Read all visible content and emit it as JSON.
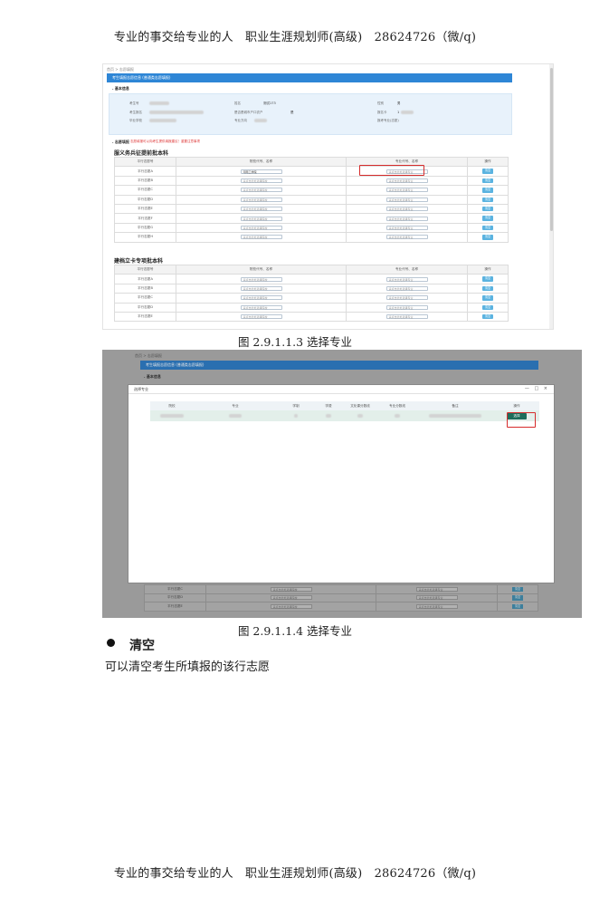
{
  "page": {
    "header": "专业的事交给专业的人　职业生涯规划师(高级)　28624726（微/q)",
    "footer": "专业的事交给专业的人　职业生涯规划师(高级)　28624726（微/q)"
  },
  "figure1": {
    "breadcrumb": "首页 > 志愿填报",
    "title_bar": "考生填报志愿信息 (普通类志愿填报)",
    "basic_info_title": ". 基本信息",
    "info": {
      "exam_no_label": "考生号",
      "candidate_no_label": "考生报名",
      "grad_school_label": "毕业学校",
      "name_label": "姓名",
      "name_value": "测试173",
      "hukou_label": "是否是城市户口农户",
      "hukou_value": "是",
      "major_label": "专业方向",
      "gender_label": "性别",
      "gender_value": "男",
      "score_label": "报名卡",
      "score_value": "1",
      "subject_label": "报考专业(志愿)"
    },
    "fill_title": ". 志愿填报",
    "warning": "志愿填报可以向考生提供填报建议！重要注意事项",
    "group1_title": "服义务兵征提前批本科",
    "group2_title": "建档立卡专项批本科",
    "table_headers": [
      "平行志愿号",
      "院校代号、名称",
      "专业代号、名称",
      "操作"
    ],
    "group1_rows": [
      "平行志愿A",
      "平行志愿B",
      "平行志愿C",
      "平行志愿D",
      "平行志愿E",
      "平行志愿F",
      "平行志愿G",
      "平行志愿H"
    ],
    "group2_rows": [
      "平行志愿A",
      "平行志愿B",
      "平行志愿C",
      "平行志愿D",
      "平行志愿E"
    ],
    "school_placeholder": "请点击此处选择院校",
    "major_placeholder": "请点击此处选择专业",
    "first_school_value": "河南工学院",
    "clear_button": "清空",
    "caption": "图 2.9.1.1.3 选择专业"
  },
  "figure2": {
    "breadcrumb": "首页 > 志愿填报",
    "title_bar": "考生填报志愿信息 (普通类志愿填报)",
    "basic_info_title": ". 基本信息",
    "modal_title": "选择专业",
    "modal_controls": "— □ ×",
    "headers": [
      "院校",
      "专业",
      "学制",
      "学费",
      "文化课分数线",
      "专业分数线",
      "备注",
      "操作"
    ],
    "select_button": "选择",
    "bg_rows": [
      "平行志愿C",
      "平行志愿D",
      "平行志愿E"
    ],
    "school_placeholder": "请点击此处选择院校",
    "major_placeholder": "请点击此处选择专业",
    "clear_button": "清空",
    "caption": "图 2.9.1.1.4 选择专业"
  },
  "section": {
    "bullet_title": "清空",
    "text": "可以清空考生所填报的该行志愿"
  }
}
